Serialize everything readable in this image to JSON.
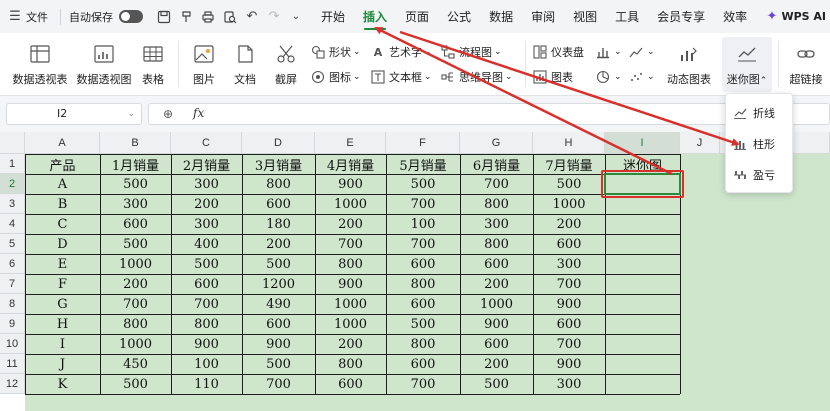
{
  "menubar": {
    "file_label": "文件",
    "autosave_label": "自动保存",
    "tabs": [
      {
        "label": "开始",
        "active": false
      },
      {
        "label": "插入",
        "active": true
      },
      {
        "label": "页面",
        "active": false
      },
      {
        "label": "公式",
        "active": false
      },
      {
        "label": "数据",
        "active": false
      },
      {
        "label": "审阅",
        "active": false
      },
      {
        "label": "视图",
        "active": false
      },
      {
        "label": "工具",
        "active": false
      },
      {
        "label": "会员专享",
        "active": false
      },
      {
        "label": "效率",
        "active": false
      }
    ],
    "brand": "WPS AI"
  },
  "ribbon": {
    "pivot_table": "数据透视表",
    "pivot_chart": "数据透视图",
    "table": "表格",
    "picture": "图片",
    "document": "文档",
    "screenshot": "截屏",
    "shape": "形状",
    "icon": "图标",
    "art_text": "艺术字",
    "text_box": "文本框",
    "flowchart": "流程图",
    "mindmap": "思维导图",
    "dashboard": "仪表盘",
    "chart": "图表",
    "dynamic_chart": "动态图表",
    "sparkline": "迷你图",
    "hyperlink": "超链接"
  },
  "formula_bar": {
    "name_box": "I2",
    "fx": "fx",
    "formula": ""
  },
  "sheet": {
    "columns": [
      "A",
      "B",
      "C",
      "D",
      "E",
      "F",
      "G",
      "H",
      "I",
      "J"
    ],
    "rows": [
      "1",
      "2",
      "3",
      "4",
      "5",
      "6",
      "7",
      "8",
      "9",
      "10",
      "11",
      "12"
    ],
    "header": [
      "产品",
      "1月销量",
      "2月销量",
      "3月销量",
      "4月销量",
      "5月销量",
      "6月销量",
      "7月销量",
      "迷你图"
    ],
    "data": [
      [
        "A",
        "500",
        "300",
        "800",
        "900",
        "500",
        "700",
        "500"
      ],
      [
        "B",
        "300",
        "200",
        "600",
        "1000",
        "700",
        "800",
        "1000"
      ],
      [
        "C",
        "600",
        "300",
        "180",
        "200",
        "100",
        "300",
        "200"
      ],
      [
        "D",
        "500",
        "400",
        "200",
        "700",
        "700",
        "800",
        "600"
      ],
      [
        "E",
        "1000",
        "500",
        "500",
        "800",
        "600",
        "600",
        "300"
      ],
      [
        "F",
        "200",
        "600",
        "1200",
        "900",
        "800",
        "200",
        "700"
      ],
      [
        "G",
        "700",
        "700",
        "490",
        "1000",
        "600",
        "1000",
        "900"
      ],
      [
        "H",
        "800",
        "800",
        "600",
        "1000",
        "500",
        "900",
        "600"
      ],
      [
        "I",
        "1000",
        "900",
        "900",
        "200",
        "800",
        "600",
        "700"
      ],
      [
        "J",
        "450",
        "100",
        "500",
        "800",
        "600",
        "200",
        "900"
      ],
      [
        "K",
        "500",
        "110",
        "700",
        "600",
        "700",
        "500",
        "300"
      ]
    ]
  },
  "sparkline_menu": {
    "items": [
      {
        "label": "折线",
        "icon": "line-sparkline-icon"
      },
      {
        "label": "柱形",
        "icon": "column-sparkline-icon"
      },
      {
        "label": "盈亏",
        "icon": "winloss-sparkline-icon"
      }
    ]
  },
  "colors": {
    "accent": "#1e8a3b",
    "fill": "#cfe6cd",
    "annotation": "#d8302c"
  }
}
